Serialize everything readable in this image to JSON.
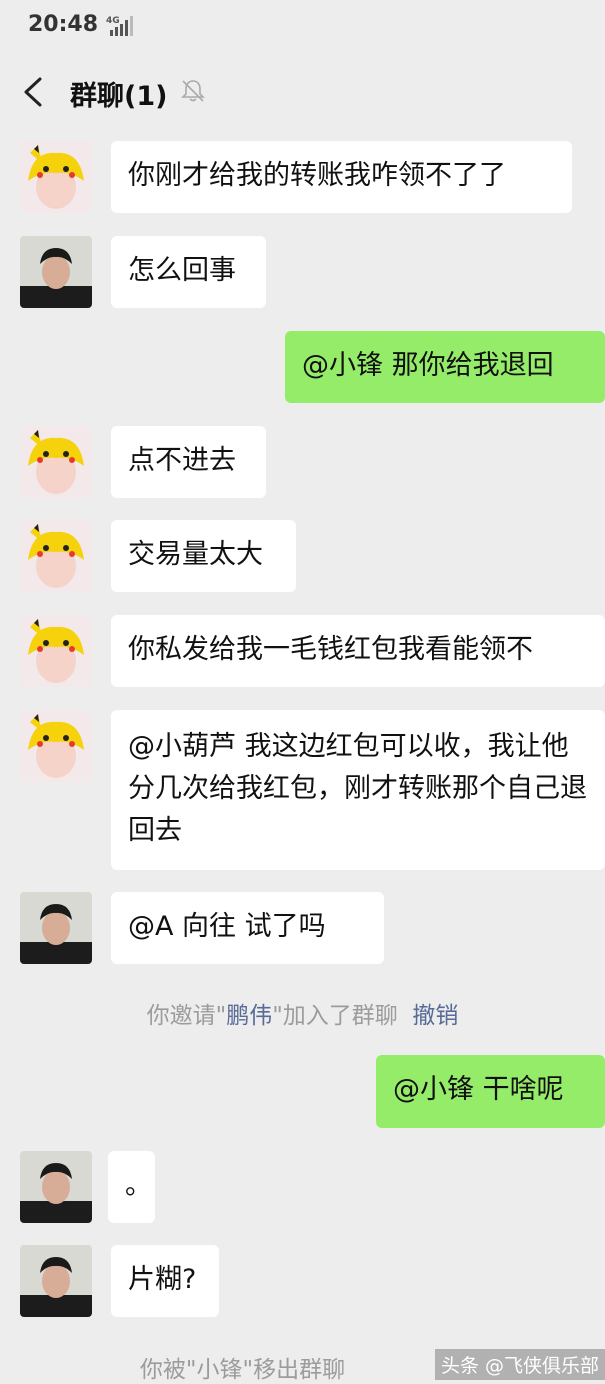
{
  "status_bar": {
    "time": "20:48",
    "network": "4G"
  },
  "header": {
    "title": "群聊(1)",
    "back_icon": "chevron-left-icon",
    "mute_icon": "bell-muted-icon"
  },
  "colors": {
    "background": "#ededed",
    "bubble_self": "#95ec69",
    "bubble_other": "#ffffff",
    "link": "#576b95",
    "system_text": "#9c9c9c"
  },
  "messages": [
    {
      "sender": "pikachu-hat-user",
      "side": "left",
      "text": "你刚才给我的转账我咋领不了了"
    },
    {
      "sender": "dark-hair-user",
      "side": "left",
      "text": "怎么回事"
    },
    {
      "sender": "self",
      "side": "right",
      "text": "@小锋  那你给我退回"
    },
    {
      "sender": "pikachu-hat-user",
      "side": "left",
      "text": "点不进去"
    },
    {
      "sender": "pikachu-hat-user",
      "side": "left",
      "text": "交易量太大"
    },
    {
      "sender": "pikachu-hat-user",
      "side": "left",
      "text": "你私发给我一毛钱红包我看能领不"
    },
    {
      "sender": "pikachu-hat-user",
      "side": "left",
      "text": "@小葫芦  我这边红包可以收，我让他分几次给我红包，刚才转账那个自己退回去"
    },
    {
      "sender": "dark-hair-user",
      "side": "left",
      "text": "@A  向往  试了吗"
    },
    {
      "sender": "self",
      "side": "right",
      "text": "@小锋  干啥呢"
    },
    {
      "sender": "dark-hair-user",
      "side": "left",
      "text": "。"
    },
    {
      "sender": "dark-hair-user",
      "side": "left",
      "text": "片糊?"
    }
  ],
  "system_notices": {
    "invite": {
      "prefix": "你邀请\"",
      "name": "鹏伟",
      "suffix": "\"加入了群聊",
      "action": "撤销"
    },
    "removed": "你被\"小锋\"移出群聊"
  },
  "watermark": "头条 @飞侠俱乐部"
}
